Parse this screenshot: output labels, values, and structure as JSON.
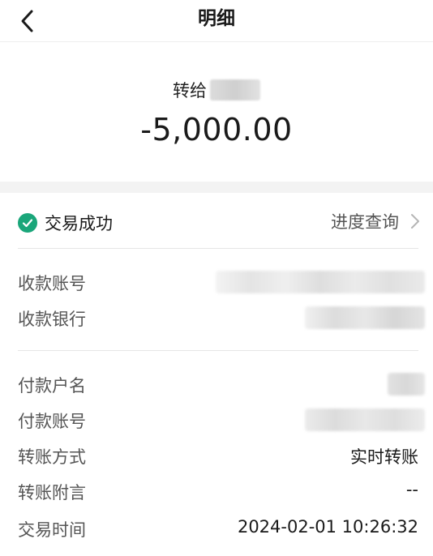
{
  "header": {
    "title": "明细",
    "back_icon": "chevron-left-icon"
  },
  "summary": {
    "recipient_prefix": "转给",
    "amount": "-5,000.00"
  },
  "status": {
    "text": "交易成功",
    "link_label": "进度查询",
    "accent_color": "#1aa67a"
  },
  "payee_details": {
    "account_label": "收款账号",
    "bank_label": "收款银行"
  },
  "payer_details": {
    "name_label": "付款户名",
    "account_label": "付款账号",
    "method_label": "转账方式",
    "method_value": "实时转账",
    "note_label": "转账附言",
    "note_value": "--",
    "time_label": "交易时间",
    "time_value": "2024-02-01 10:26:32"
  }
}
